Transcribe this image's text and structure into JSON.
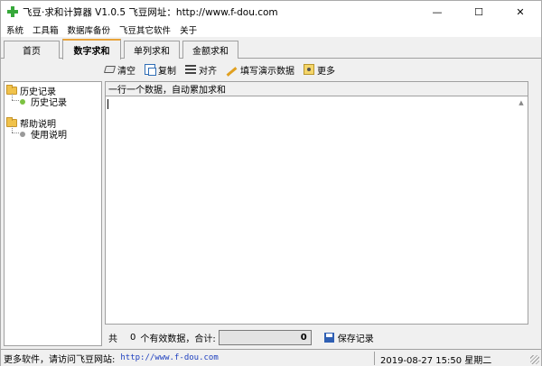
{
  "window": {
    "title": "飞豆·求和计算器 V1.0.5  飞豆网址：http://www.f-dou.com",
    "controls": [
      "—",
      "☐",
      "✕"
    ]
  },
  "menu": [
    "系统",
    "工具箱",
    "数据库备份",
    "飞豆其它软件",
    "关于"
  ],
  "tabs": [
    {
      "label": "首页",
      "active": false
    },
    {
      "label": "数字求和",
      "active": true
    },
    {
      "label": "单列求和",
      "active": false
    },
    {
      "label": "金额求和",
      "active": false
    }
  ],
  "toolbar": {
    "clear": "清空",
    "copy": "复制",
    "align": "对齐",
    "fill_demo": "填写演示数据",
    "more": "更多"
  },
  "tree": {
    "history_group": "历史记录",
    "history_item": "历史记录",
    "help_group": "帮助说明",
    "help_item": "使用说明"
  },
  "panel": {
    "header": "一行一个数据，自动累加求和"
  },
  "summary": {
    "prefix": "共",
    "count": "0",
    "suffix": "个有效数据，合计:",
    "total": "0",
    "save": "保存记录"
  },
  "status": {
    "left_text": "更多软件，请访问飞豆网站:",
    "link": "http://www.f-dou.com",
    "datetime": "2019-08-27 15:50 星期二"
  },
  "colors": {
    "accent_tab": "#e8a33a",
    "link": "#1d3fbf",
    "app_icon": "#36a83a"
  }
}
